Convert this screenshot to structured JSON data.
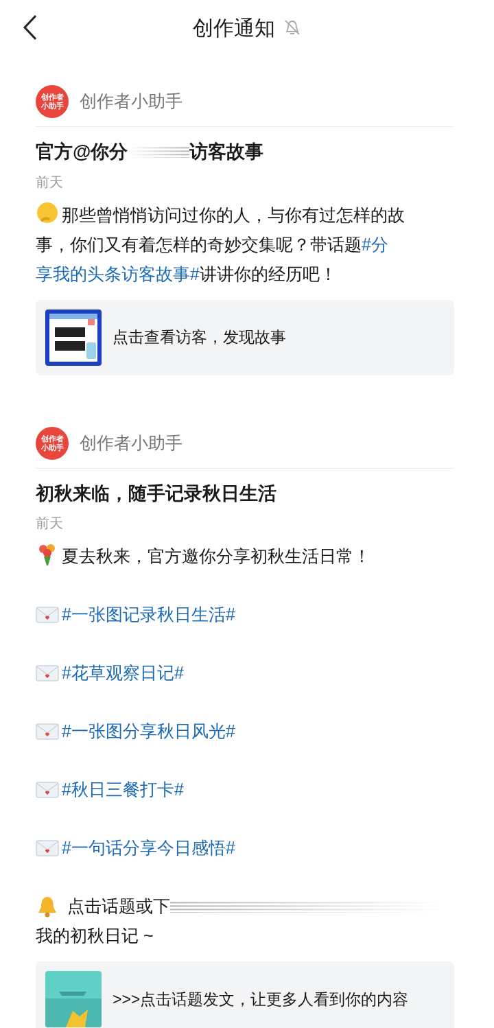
{
  "header": {
    "title": "创作通知",
    "muted": true
  },
  "messages": [
    {
      "sender": {
        "name": "创作者小助手",
        "avatar_lines": [
          "创作者",
          "小助手"
        ]
      },
      "title": [
        {
          "kind": "text",
          "text": "官方@你分"
        },
        {
          "kind": "redacted"
        },
        {
          "kind": "text",
          "text": "访客故事"
        }
      ],
      "time": "前天",
      "paragraphs": [
        {
          "kind": "thinking",
          "lines": [
            [
              {
                "kind": "text",
                "text": "那些曾悄悄访问过你的人，与你有过怎样的故"
              }
            ],
            [
              {
                "kind": "text",
                "text": "事，你们又有着怎样的奇妙交集呢？带话题"
              },
              {
                "kind": "topic",
                "text": "#分"
              }
            ],
            [
              {
                "kind": "topic",
                "text": "享我的头条访客故事#"
              },
              {
                "kind": "text",
                "text": "讲讲你的经历吧！"
              }
            ]
          ]
        }
      ],
      "card": {
        "kind": "grid",
        "text": "点击查看访客，发现故事"
      }
    },
    {
      "sender": {
        "name": "创作者小助手",
        "avatar_lines": [
          "创作者",
          "小助手"
        ]
      },
      "title": [
        {
          "kind": "text",
          "text": "初秋来临，随手记录秋日生活"
        }
      ],
      "time": "前天",
      "paragraphs": [
        {
          "kind": "bouquet",
          "lines": [
            [
              {
                "kind": "text",
                "text": "夏去秋来，官方邀你分享初秋生活日常！"
              }
            ]
          ]
        },
        {
          "kind": "envelope",
          "lines": [
            [
              {
                "kind": "topic",
                "text": "#一张图记录秋日生活#"
              }
            ]
          ]
        },
        {
          "kind": "envelope",
          "lines": [
            [
              {
                "kind": "topic",
                "text": "#花草观察日记#"
              }
            ]
          ]
        },
        {
          "kind": "envelope",
          "lines": [
            [
              {
                "kind": "topic",
                "text": "#一张图分享秋日风光#"
              }
            ]
          ]
        },
        {
          "kind": "envelope",
          "lines": [
            [
              {
                "kind": "topic",
                "text": "#秋日三餐打卡#"
              }
            ]
          ]
        },
        {
          "kind": "envelope",
          "lines": [
            [
              {
                "kind": "topic",
                "text": "#一句话分享今日感悟#"
              }
            ]
          ]
        },
        {
          "kind": "bell",
          "lines": [
            [
              {
                "kind": "text",
                "text": "点击话题或下"
              },
              {
                "kind": "redacted"
              }
            ],
            [
              {
                "kind": "text",
                "text": "我的初秋日记 ~"
              }
            ]
          ]
        }
      ],
      "card": {
        "kind": "leaf",
        "text": ">>>点击话题发文，让更多人看到你的内容"
      }
    }
  ]
}
